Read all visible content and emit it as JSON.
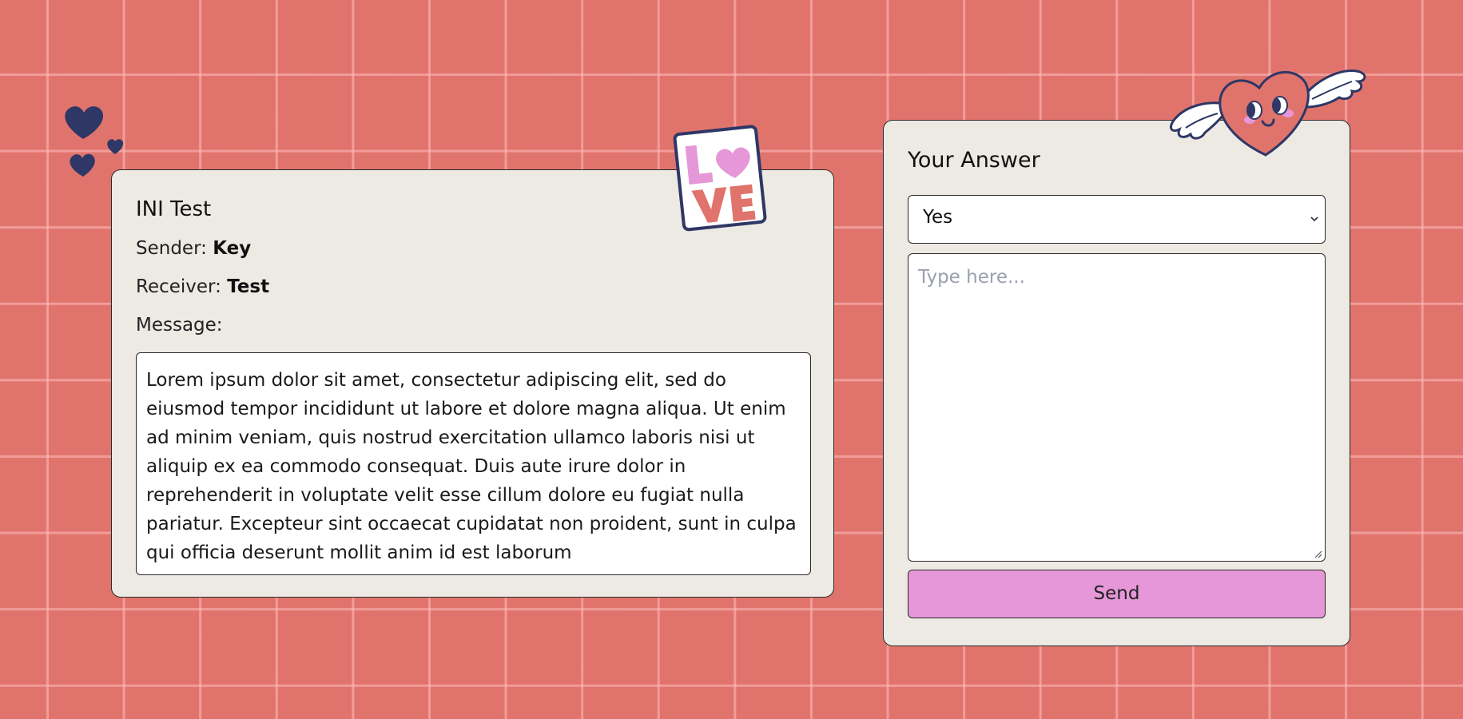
{
  "message_card": {
    "title": "INI Test",
    "sender_label": "Sender:",
    "sender_value": "Key",
    "receiver_label": "Receiver:",
    "receiver_value": "Test",
    "message_label": "Message:",
    "message_text": "Lorem ipsum dolor sit amet, consectetur adipiscing elit, sed do eiusmod tempor incididunt ut labore et dolore magna aliqua. Ut enim ad minim veniam, quis nostrud exercitation ullamco laboris nisi ut aliquip ex ea commodo consequat. Duis aute irure dolor in reprehenderit in voluptate velit esse cillum dolore eu fugiat nulla pariatur. Excepteur sint occaecat cupidatat non proident, sunt in culpa qui officia deserunt mollit anim id est laborum"
  },
  "sticker": {
    "line1_letters": [
      "L",
      "V",
      "E"
    ],
    "icon": "love-sticker"
  },
  "answer_card": {
    "title": "Your Answer",
    "select_value": "Yes",
    "textarea_placeholder": "Type here...",
    "send_label": "Send"
  },
  "decorations": {
    "hearts_icon": "hearts-cluster-icon",
    "winged_heart_icon": "winged-heart-icon"
  },
  "colors": {
    "background": "#e0746d",
    "grid_lines": "#f2a6a2",
    "card_background": "#ede9e3",
    "send_button": "#e597d8",
    "navy": "#2e3765",
    "pink": "#e597d8",
    "red_heart": "#e0746d"
  }
}
